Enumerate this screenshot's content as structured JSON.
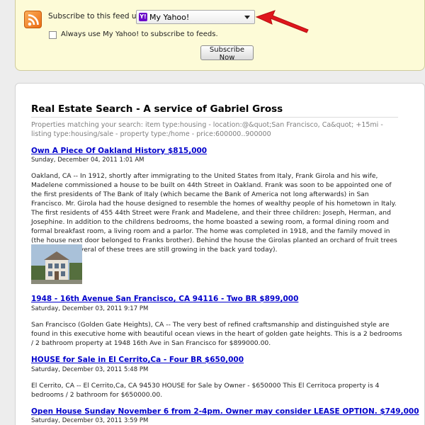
{
  "subscribe": {
    "label": "Subscribe to this feed using",
    "reader_selected": "My Yahoo!",
    "yahoo_badge": "Y!",
    "always_use_label": "Always use My Yahoo! to subscribe to feeds.",
    "button_label": "Subscribe Now"
  },
  "feed": {
    "title": "Real Estate Search - A service of Gabriel Gross",
    "description": "Properties matching your search: item type:housing - location:@&quot;San Francisco, Ca&quot; +15mi - listing type:housing/sale - property type:/home - price:600000..900000",
    "items": [
      {
        "title": "Own A Piece Of Oakland History $815,000",
        "date": "Sunday, December 04, 2011 1:01 AM",
        "body": "Oakland, CA -- In 1912, shortly after immigrating to the United States from Italy, Frank Girola and his wife, Madelene commissioned a house to be built on 44th Street in Oakland. Frank was soon to be appointed one of the first presidents of The Bank of Italy (which became the Bank of America not long afterwards) in San Francisco. Mr. Girola had the house designed to resemble the homes of wealthy people of his hometown in Italy. The first residents of 455 44th Street were Frank and Madelene, and their three children: Joseph, Herman, and Josephine. In addition to the childrens bedrooms, the home boasted a sewing room, a formal dining room and formal breakfast room, a living room and a parlor. The home was completed in 1918, and the family moved in (the house next door belonged to Franks brother). Behind the house the Girolas planted an orchard of fruit trees and grapes (several of these trees are still growing in the back yard today)."
      },
      {
        "title": "1948 - 16th Avenue San Francisco, CA 94116 - Two BR $899,000",
        "date": "Saturday, December 03, 2011 9:17 PM",
        "body": "San Francisco (Golden Gate Heights), CA -- The very best of refined craftsmanship and distinguished style are found in this executive home with beautiful ocean views in the heart of golden gate heights. This is a 2 bedrooms / 2 bathroom property at 1948 16th Ave in San Francisco for $899000.00."
      },
      {
        "title": "HOUSE for Sale in El Cerrito,Ca - Four BR $650,000",
        "date": "Saturday, December 03, 2011 5:48 PM",
        "body": "El Cerrito, CA -- El Cerrito,Ca, CA 94530 HOUSE for Sale by Owner - $650000 This El Cerritoca property is 4 bedrooms / 2 bathroom for $650000.00."
      },
      {
        "title": "Open House Sunday November 6 from 2-4pm. Owner may consider LEASE OPTION. $749,000",
        "date": "Saturday, December 03, 2011 3:59 PM",
        "body": ""
      }
    ]
  }
}
